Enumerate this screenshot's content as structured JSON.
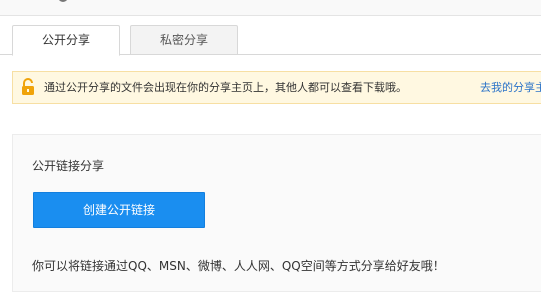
{
  "tabs": [
    {
      "label": "公开分享",
      "active": true
    },
    {
      "label": "私密分享",
      "active": false
    }
  ],
  "notice": {
    "icon": "unlock-icon",
    "text": "通过公开分享的文件会出现在你的分享主页上，其他人都可以查看下载哦。",
    "link": "去我的分享主页"
  },
  "panel": {
    "title": "公开链接分享",
    "button_label": "创建公开链接",
    "hint": "你可以将链接通过QQ、MSN、微博、人人网、QQ空间等方式分享给好友哦！"
  },
  "colors": {
    "primary_button": "#1a8ef0",
    "notice_bg": "#fff8e1",
    "notice_border": "#f7dfa3",
    "link": "#2b73c8",
    "lock": "#f0a30a"
  }
}
